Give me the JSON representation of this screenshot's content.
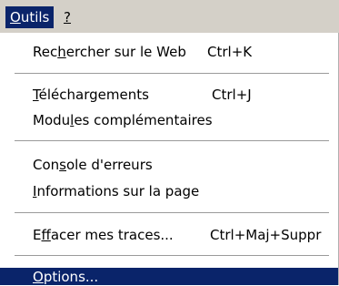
{
  "menubar": {
    "outils": {
      "first": "O",
      "rest": "utils"
    },
    "help": "?"
  },
  "menu": {
    "items": [
      {
        "label": {
          "pre": "Rec",
          "acc": "h",
          "post": "ercher sur le Web"
        },
        "shortcut": "Ctrl+K"
      },
      {
        "label": {
          "pre": "",
          "acc": "T",
          "post": "éléchargements"
        },
        "shortcut": "Ctrl+J"
      },
      {
        "label": {
          "pre": "Modu",
          "acc": "l",
          "post": "es complémentaires"
        },
        "shortcut": ""
      },
      {
        "label": {
          "pre": "Con",
          "acc": "s",
          "post": "ole d'erreurs"
        },
        "shortcut": ""
      },
      {
        "label": {
          "pre": "",
          "acc": "I",
          "post": "nformations sur la page"
        },
        "shortcut": ""
      },
      {
        "label": {
          "pre": "E",
          "acc": "f",
          "post": "facer mes traces..."
        },
        "shortcut": "Ctrl+Maj+Suppr"
      },
      {
        "label": {
          "pre": "",
          "acc": "O",
          "post": "ptions..."
        },
        "shortcut": ""
      }
    ]
  },
  "colors": {
    "highlight": "#0a246a",
    "menubar_bg": "#d4d0c8"
  }
}
